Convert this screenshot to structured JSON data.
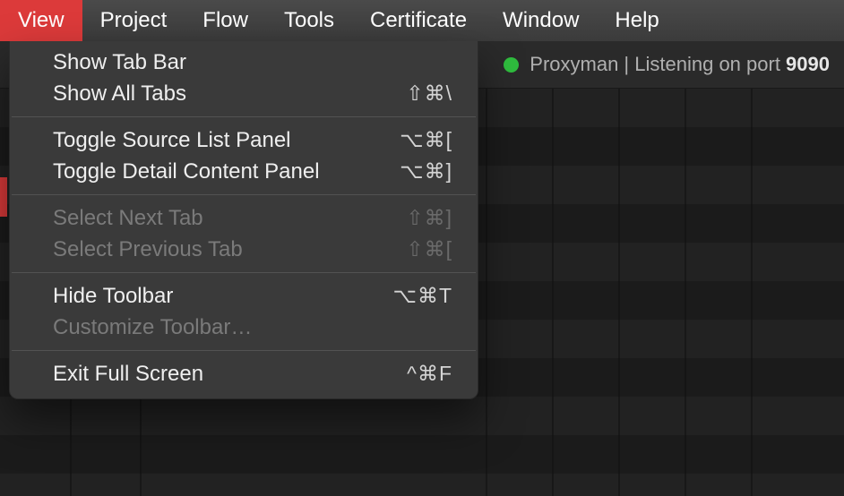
{
  "menubar": {
    "items": [
      {
        "label": "View",
        "active": true
      },
      {
        "label": "Project",
        "active": false
      },
      {
        "label": "Flow",
        "active": false
      },
      {
        "label": "Tools",
        "active": false
      },
      {
        "label": "Certificate",
        "active": false
      },
      {
        "label": "Window",
        "active": false
      },
      {
        "label": "Help",
        "active": false
      }
    ]
  },
  "status": {
    "app_name": "Proxyman",
    "separator": " | ",
    "listening_text": "Listening on port ",
    "port": "9090"
  },
  "dropdown": {
    "groups": [
      {
        "items": [
          {
            "label": "Show Tab Bar",
            "shortcut": "",
            "disabled": false
          },
          {
            "label": "Show All Tabs",
            "shortcut": "⇧⌘\\",
            "disabled": false
          }
        ]
      },
      {
        "items": [
          {
            "label": "Toggle Source List Panel",
            "shortcut": "⌥⌘[",
            "disabled": false
          },
          {
            "label": "Toggle Detail Content Panel",
            "shortcut": "⌥⌘]",
            "disabled": false
          }
        ]
      },
      {
        "items": [
          {
            "label": "Select Next Tab",
            "shortcut": "⇧⌘]",
            "disabled": true
          },
          {
            "label": "Select Previous Tab",
            "shortcut": "⇧⌘[",
            "disabled": true
          }
        ]
      },
      {
        "items": [
          {
            "label": "Hide Toolbar",
            "shortcut": "⌥⌘T",
            "disabled": false
          },
          {
            "label": "Customize Toolbar…",
            "shortcut": "",
            "disabled": true
          }
        ]
      },
      {
        "items": [
          {
            "label": "Exit Full Screen",
            "shortcut": "^⌘F",
            "disabled": false
          }
        ]
      }
    ]
  }
}
